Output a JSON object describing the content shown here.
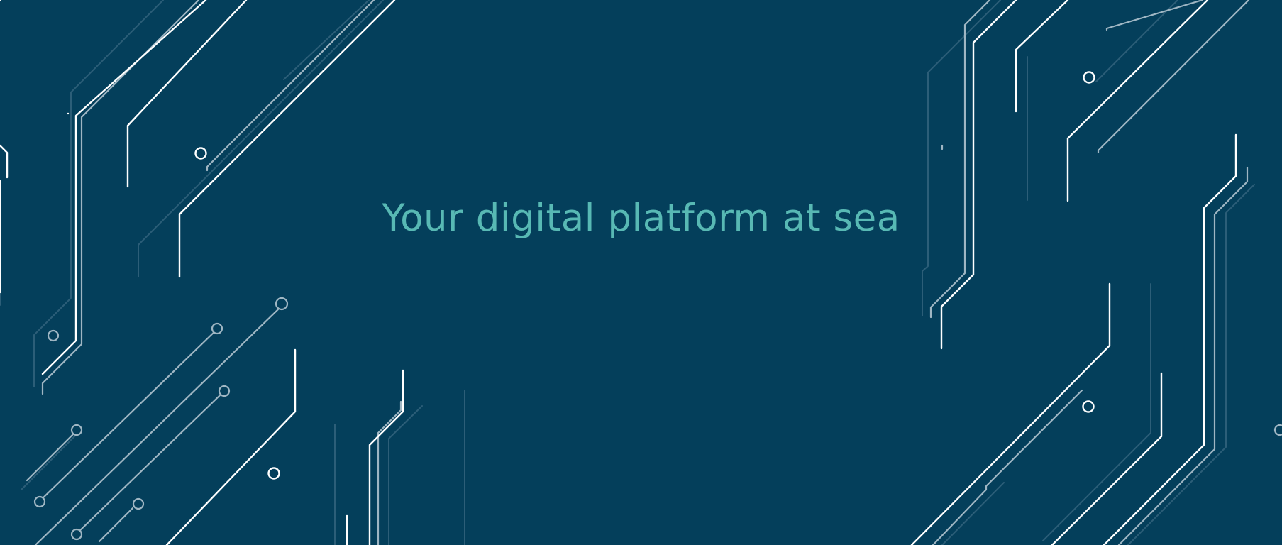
{
  "hero": {
    "headline": "Your digital platform at sea",
    "background_color": "#043f5b",
    "headline_color": "#58b9b4",
    "art": {
      "name": "circuit-lines-decoration",
      "line_color": "#ffffff",
      "muted_line_color": "#5f8aa0"
    }
  }
}
